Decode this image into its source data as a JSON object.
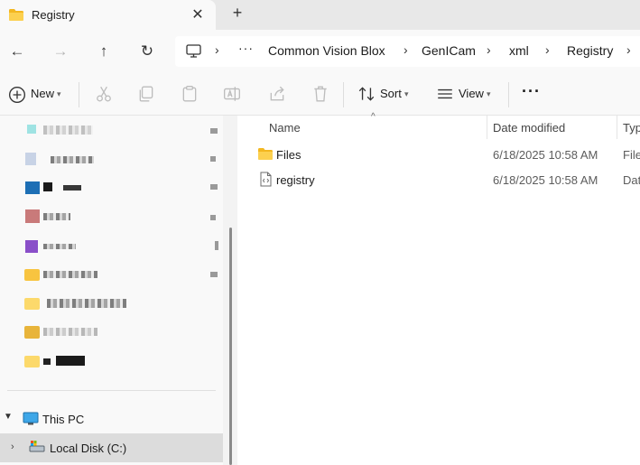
{
  "window": {
    "tab_title": "Registry",
    "close_glyph": "✕",
    "new_tab_glyph": "+"
  },
  "navigation": {
    "back_glyph": "←",
    "forward_glyph": "→",
    "up_glyph": "↑",
    "refresh_glyph": "↻"
  },
  "breadcrumb": {
    "more_glyph": "···",
    "separator": "›",
    "items": [
      "Common Vision Blox",
      "GenICam",
      "xml",
      "Registry"
    ]
  },
  "toolbar": {
    "new_label": "New",
    "sort_label": "Sort",
    "view_label": "View",
    "more_glyph": "···"
  },
  "nav_pane": {
    "this_pc_label": "This PC",
    "local_disk_label": "Local Disk (C:)"
  },
  "file_list": {
    "columns": {
      "name": "Name",
      "date_modified": "Date modified",
      "type": "Typ"
    },
    "rows": [
      {
        "name": "Files",
        "date": "6/18/2025 10:58 AM",
        "type": "File",
        "icon": "folder-icon"
      },
      {
        "name": "registry",
        "date": "6/18/2025 10:58 AM",
        "type": "Dat",
        "icon": "xml-file-icon"
      }
    ]
  },
  "colors": {
    "accent": "#0067c0",
    "folder_yellow": "#f8c440",
    "selected_row": "#dcdcdc"
  }
}
